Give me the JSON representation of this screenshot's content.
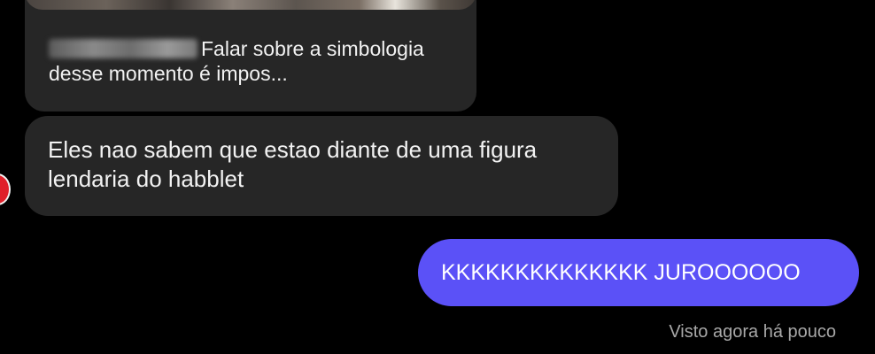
{
  "shared_post": {
    "caption_text": "Falar sobre a simbologia desse momento é impos..."
  },
  "messages": [
    {
      "direction": "received",
      "text": "Eles nao sabem que estao diante de uma figura lendaria do habblet"
    },
    {
      "direction": "sent",
      "text": "KKKKKKKKKKKKKK JUROOOOOO"
    }
  ],
  "status": {
    "seen_text": "Visto agora há pouco"
  },
  "colors": {
    "background": "#000000",
    "received_bubble": "#262626",
    "sent_bubble": "#5b51f7",
    "status_text": "#a8a8a8"
  }
}
